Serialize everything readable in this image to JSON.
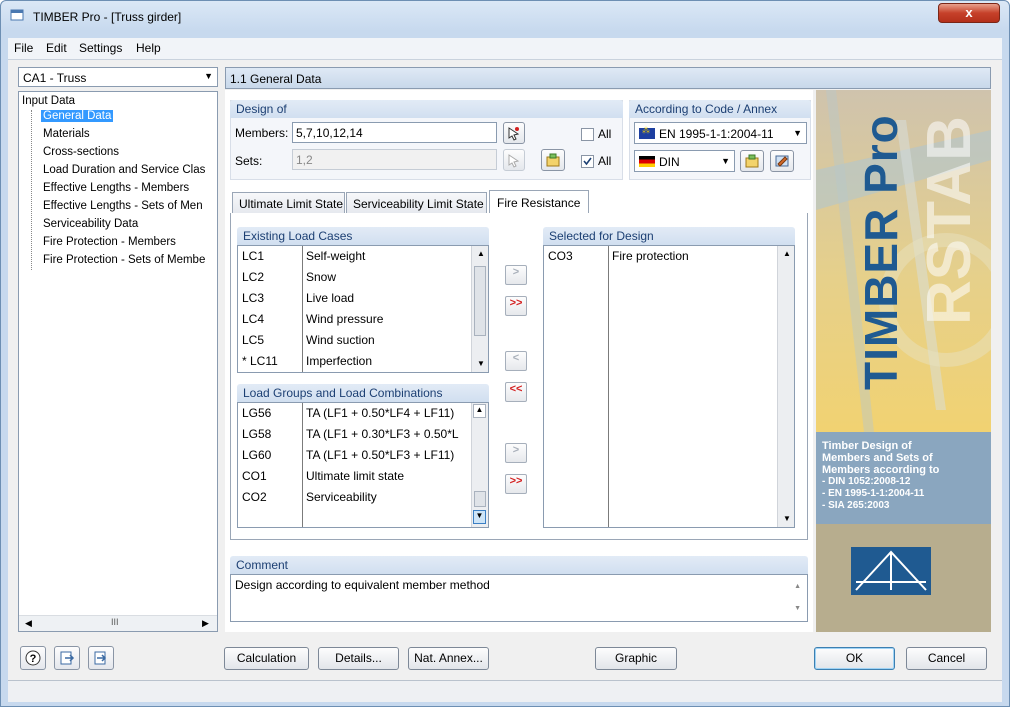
{
  "window": {
    "title": "TIMBER Pro - [Truss girder]",
    "close_label": "x"
  },
  "menu": [
    "File",
    "Edit",
    "Settings",
    "Help"
  ],
  "case_combo": {
    "value": "CA1 - Truss"
  },
  "tree": {
    "root": "Input Data",
    "items": [
      "General Data",
      "Materials",
      "Cross-sections",
      "Load Duration and Service Clas",
      "Effective Lengths - Members",
      "Effective Lengths - Sets of Men",
      "Serviceability Data",
      "Fire Protection - Members",
      "Fire Protection - Sets of Membe"
    ],
    "selected": 0,
    "scroll_grip": "III"
  },
  "header": {
    "title": "1.1 General Data"
  },
  "design_of": {
    "title": "Design of",
    "members_label": "Members:",
    "members_value": "5,7,10,12,14",
    "sets_label": "Sets:",
    "sets_value": "1,2",
    "all_label": "All",
    "all_members_checked": false,
    "all_sets_checked": true
  },
  "code": {
    "title": "According to Code / Annex",
    "code_value": "EN 1995-1-1:2004-11",
    "annex_value": "DIN"
  },
  "tabs": [
    "Ultimate Limit State",
    "Serviceability Limit State",
    "Fire Resistance"
  ],
  "active_tab": 2,
  "existing_load_cases": {
    "title": "Existing Load Cases",
    "rows": [
      {
        "id": "LC1",
        "name": "Self-weight"
      },
      {
        "id": "LC2",
        "name": "Snow"
      },
      {
        "id": "LC3",
        "name": "Live load"
      },
      {
        "id": "LC4",
        "name": "Wind pressure"
      },
      {
        "id": "LC5",
        "name": "Wind suction"
      },
      {
        "id": "* LC11",
        "name": "Imperfection"
      }
    ]
  },
  "load_groups": {
    "title": "Load Groups and Load Combinations",
    "rows": [
      {
        "id": "LG56",
        "name": "TA  (LF1 + 0.50*LF4 + LF11)"
      },
      {
        "id": "LG58",
        "name": "TA  (LF1 + 0.30*LF3 + 0.50*L"
      },
      {
        "id": "LG60",
        "name": "TA  (LF1 + 0.50*LF3 + LF11)"
      },
      {
        "id": "CO1",
        "name": "Ultimate limit state"
      },
      {
        "id": "CO2",
        "name": "Serviceability"
      }
    ]
  },
  "selected_for_design": {
    "title": "Selected for Design",
    "rows": [
      {
        "id": "CO3",
        "name": "Fire protection"
      }
    ]
  },
  "transfer": {
    "one": ">",
    "all": ">>",
    "back_one": "<",
    "back_all": "<<"
  },
  "comment": {
    "title": "Comment",
    "value": "Design according to equivalent member method"
  },
  "side_image": {
    "product": "TIMBER Pro",
    "rstab": "RSTAB",
    "desc": [
      "Timber Design of",
      "Members and Sets of",
      "Members according to"
    ],
    "standards": [
      "- DIN 1052:2008-12",
      "- EN 1995-1-1:2004-11",
      "- SIA 265:2003"
    ]
  },
  "buttons": {
    "calculation": "Calculation",
    "details": "Details...",
    "nat_annex": "Nat. Annex...",
    "graphic": "Graphic",
    "ok": "OK",
    "cancel": "Cancel"
  },
  "colors": {
    "selection": "#3399ff",
    "header": "#1c3f73",
    "red_arrow": "#d42020"
  }
}
